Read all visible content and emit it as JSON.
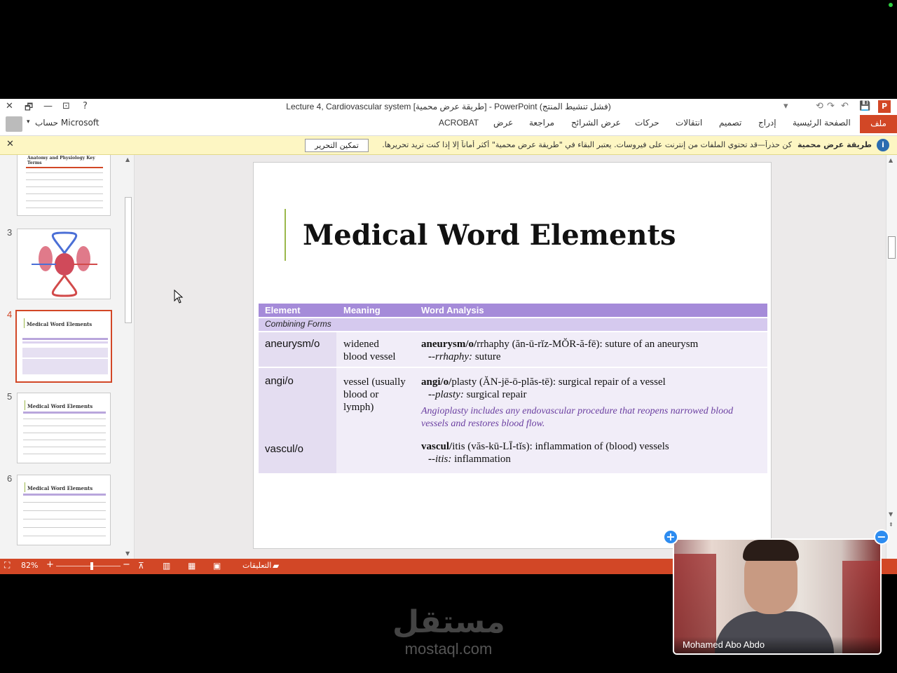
{
  "window": {
    "title": "Lecture 4, Cardiovascular system [طريقة عرض محمية] - PowerPoint (فشل تنشيط المنتج)",
    "controls": {
      "close": "✕",
      "restore": "🗗",
      "minimize": "—",
      "ribbon_display": "⊡",
      "help": "?"
    },
    "quick_access": {
      "save": "💾",
      "undo": "↶",
      "redo": "↷",
      "customize": "▾",
      "start_from_beginning": "⟲"
    }
  },
  "account": {
    "label": "حساب Microsoft",
    "caret": "▾"
  },
  "ribbon": {
    "tabs": [
      "ملف",
      "الصفحة الرئيسية",
      "إدراج",
      "تصميم",
      "انتقالات",
      "حركات",
      "عرض الشرائح",
      "مراجعة",
      "عرض",
      "ACROBAT"
    ],
    "active_color": "#d24726"
  },
  "protected_view": {
    "title": "طريقة عرض محمية",
    "message": "كن حذراً—قد تحتوي الملفات من إنترنت على فيروسات. يعتبر البقاء في \"طريقة عرض محمية\" أكثر أماناً إلا إذا كنت تريد تحريرها.",
    "enable_button": "تمكين التحرير",
    "close": "✕",
    "icon": "shield-icon"
  },
  "thumbnails": {
    "items": [
      {
        "number": "",
        "title": "Anatomy and Physiology Key Terms"
      },
      {
        "number": "3",
        "title": ""
      },
      {
        "number": "4",
        "title": "Medical Word Elements",
        "selected": true
      },
      {
        "number": "5",
        "title": "Medical Word Elements"
      },
      {
        "number": "6",
        "title": "Medical Word Elements"
      }
    ]
  },
  "slide": {
    "title": "Medical Word Elements",
    "table": {
      "headers": [
        "Element",
        "Meaning",
        "Word Analysis"
      ],
      "section": "Combining Forms",
      "rows": [
        {
          "element": "aneurysm/o",
          "meaning_1": "widened",
          "meaning_2": "blood vessel",
          "analysis_term": "aneurysm/o/",
          "analysis_rest": "rrhaphy (ăn-ū-rĭz-MŎR-ă-fē): suture of an aneurysm",
          "suffix": "-rrhaphy:",
          "suffix_meaning": " suture"
        },
        {
          "element": "angi/o",
          "meaning_1": "vessel (usually",
          "meaning_2": "blood or",
          "meaning_3": "lymph)",
          "analysis_term": "angi/o/",
          "analysis_rest": "plasty (ĂN-jē-ō-plăs-tē): surgical repair of a vessel",
          "suffix": "-plasty:",
          "suffix_meaning": " surgical repair",
          "note_1": "Angioplasty includes any endovascular procedure that reopens narrowed blood",
          "note_2": "vessels and restores blood flow."
        },
        {
          "element": "vascul/o",
          "analysis_term": "vascul/",
          "analysis_rest": "itis (văs-kū-LĪ-tĭs): inflammation of (blood) vessels",
          "suffix": "-itis:",
          "suffix_meaning": " inflammation"
        }
      ]
    }
  },
  "statusbar": {
    "zoom": "82%",
    "zoom_in": "+",
    "zoom_out": "−",
    "comments": "التعليقات",
    "zoom_level": 0.55
  },
  "video": {
    "participant": "Mohamed Abo Abdo",
    "add": "+",
    "remove": "−"
  },
  "watermark": {
    "arabic": "مستقل",
    "url": "mostaql.com"
  }
}
